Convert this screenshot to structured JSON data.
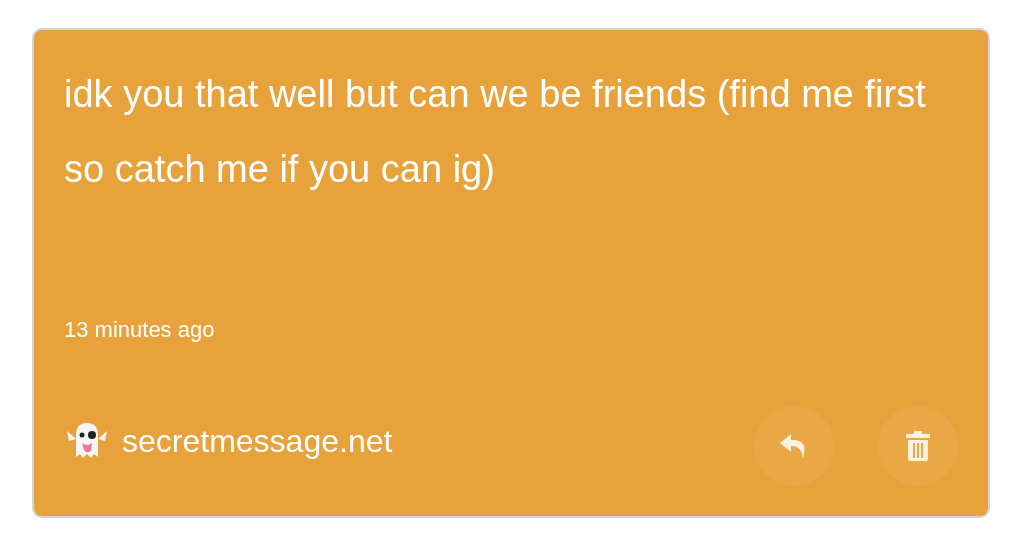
{
  "message": {
    "text": "idk you that well but can we be friends (find me first so catch me if you can ig)",
    "time": "13 minutes ago"
  },
  "brand": {
    "label": "secretmessage.net"
  },
  "actions": [
    {
      "kind": "reply"
    },
    {
      "kind": "delete"
    }
  ]
}
